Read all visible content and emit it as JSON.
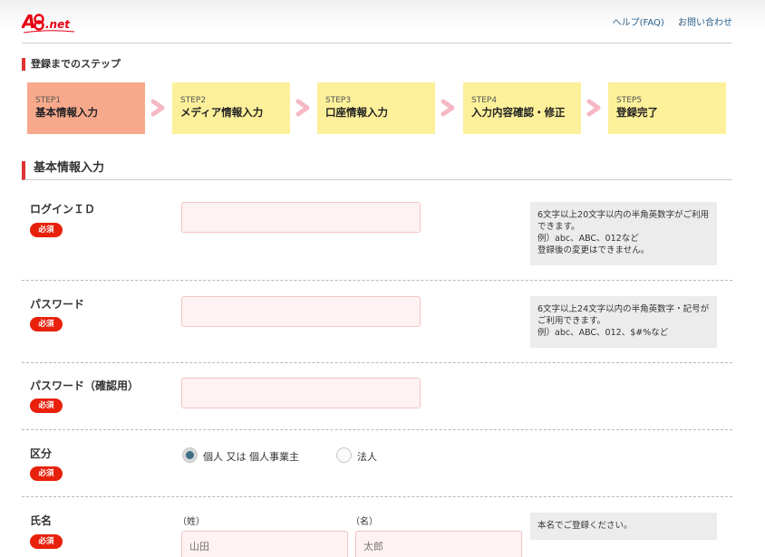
{
  "header": {
    "logo_text": "A8.net",
    "help_link": "ヘルプ(FAQ)",
    "contact_link": "お問い合わせ"
  },
  "steps": {
    "title": "登録までのステップ",
    "items": [
      {
        "num": "STEP1",
        "label": "基本情報入力",
        "active": true
      },
      {
        "num": "STEP2",
        "label": "メディア情報入力",
        "active": false
      },
      {
        "num": "STEP3",
        "label": "口座情報入力",
        "active": false
      },
      {
        "num": "STEP4",
        "label": "入力内容確認・修正",
        "active": false
      },
      {
        "num": "STEP5",
        "label": "登録完了",
        "active": false
      }
    ]
  },
  "section": {
    "title": "基本情報入力"
  },
  "required_label": "必須",
  "form": {
    "login_id": {
      "label": "ログインＩＤ",
      "value": "",
      "hint": [
        "6文字以上20文字以内の半角英数字がご利用できます。",
        "例）abc、ABC、012など",
        "登録後の変更はできません。"
      ]
    },
    "password": {
      "label": "パスワード",
      "value": "",
      "hint": [
        "6文字以上24文字以内の半角英数字・記号がご利用できます。",
        "例）abc、ABC、012、$#%など"
      ]
    },
    "password_confirm": {
      "label": "パスワード（確認用）",
      "value": ""
    },
    "category": {
      "label": "区分",
      "options": [
        {
          "label": "個人 又は 個人事業主",
          "checked": true
        },
        {
          "label": "法人",
          "checked": false
        }
      ]
    },
    "name": {
      "label": "氏名",
      "last_label": "（姓）",
      "first_label": "（名）",
      "last_placeholder": "山田",
      "first_placeholder": "太郎",
      "hint": "本名でご登録ください。"
    }
  },
  "colors": {
    "accent_red": "#e8210c",
    "step_active": "#f8a98c",
    "step_inactive": "#fdf09a",
    "chevron": "#f5b8c4",
    "input_bg": "#fff2f2"
  }
}
